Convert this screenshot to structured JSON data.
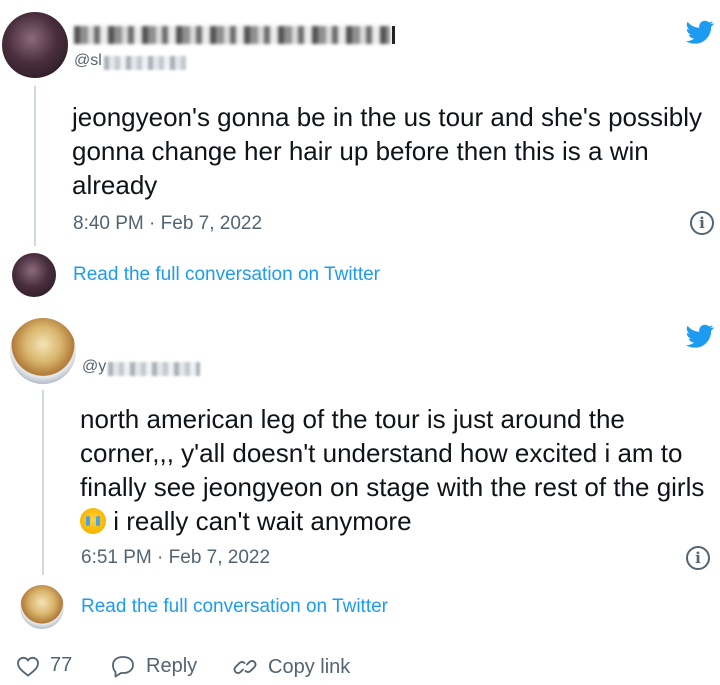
{
  "tweets": [
    {
      "handle_prefix": "@sl",
      "text": "jeongyeon's gonna be in the us tour and she's possibly gonna change her hair up before then this is a win already",
      "timestamp": "8:40 PM · Feb 7, 2022",
      "read_more": "Read the full conversation on Twitter"
    },
    {
      "handle_prefix": "@y",
      "text_before_emoji": "north american leg of the tour is just around the corner,,, y'all doesn't understand how excited i am to finally see jeongyeon on stage with the rest of the girls",
      "text_after_emoji": " i really can't wait anymore",
      "timestamp": "6:51 PM · Feb 7, 2022",
      "read_more": "Read the full conversation on Twitter"
    }
  ],
  "footer": {
    "likes": "77",
    "reply_label": "Reply",
    "copy_link_label": "Copy link"
  },
  "icons": {
    "brand": "twitter-bird-icon",
    "info": "info-icon",
    "like": "heart-icon",
    "reply": "speech-bubble-icon",
    "copy": "link-icon"
  },
  "colors": {
    "accent": "#1d9bf0",
    "muted": "#536471",
    "text": "#0f1419"
  }
}
